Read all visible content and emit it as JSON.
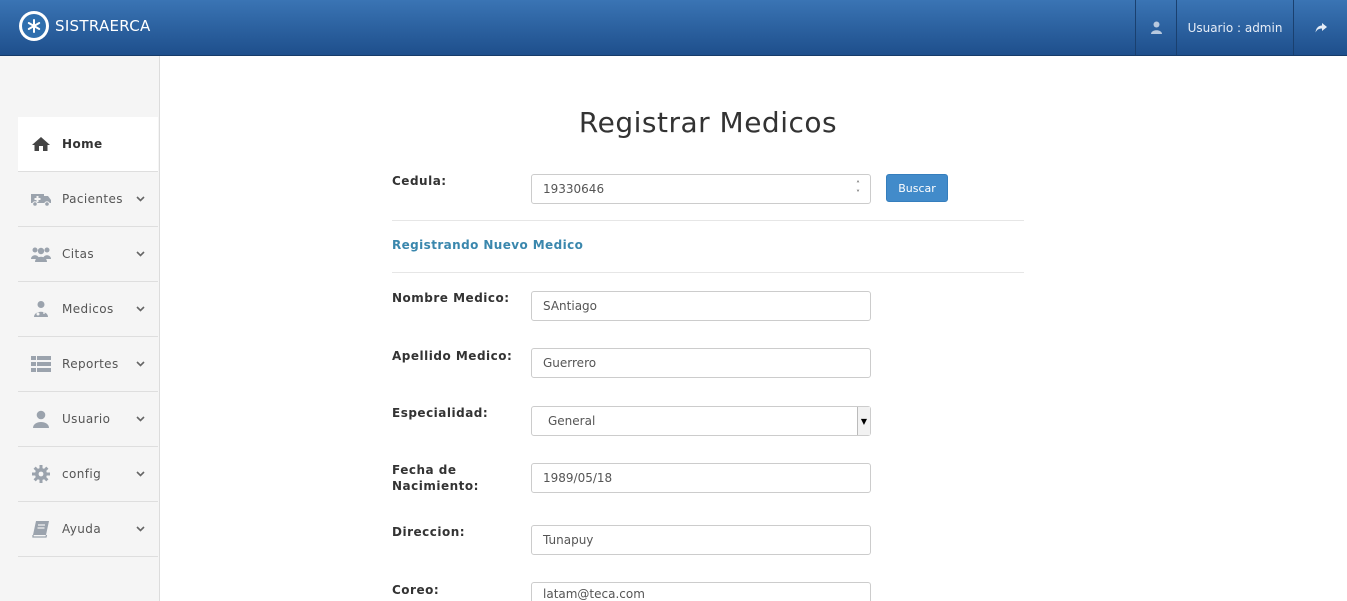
{
  "navbar": {
    "brand": "SISTRAERCA",
    "user_label": "Usuario : admin",
    "user_icon": "user-icon",
    "logout_icon": "share-icon"
  },
  "sidebar": {
    "items": [
      {
        "label": "Home",
        "icon": "home-icon",
        "active": true
      },
      {
        "label": "Pacientes",
        "icon": "ambulance-icon"
      },
      {
        "label": "Citas",
        "icon": "users-icon"
      },
      {
        "label": "Medicos",
        "icon": "doctor-icon"
      },
      {
        "label": "Reportes",
        "icon": "list-icon"
      },
      {
        "label": "Usuario",
        "icon": "user-icon"
      },
      {
        "label": "config",
        "icon": "gear-icon"
      },
      {
        "label": "Ayuda",
        "icon": "book-icon"
      }
    ]
  },
  "main": {
    "title": "Registrar Medicos",
    "cedula_label": "Cedula:",
    "cedula_value": "19330646",
    "search_button": "Buscar",
    "section_title": "Registrando Nuevo Medico",
    "nombre_label": "Nombre Medico:",
    "nombre_value": "SAntiago",
    "apellido_label": "Apellido Medico:",
    "apellido_value": "Guerrero",
    "especialidad_label": "Especialidad:",
    "especialidad_value": "General",
    "fecha_label_line1": "Fecha de",
    "fecha_label_line2": "Nacimiento:",
    "fecha_value": "1989/05/18",
    "direccion_label": "Direccion:",
    "direccion_value": "Tunapuy",
    "correo_label": "Coreo:",
    "correo_value": "latam@teca.com"
  }
}
